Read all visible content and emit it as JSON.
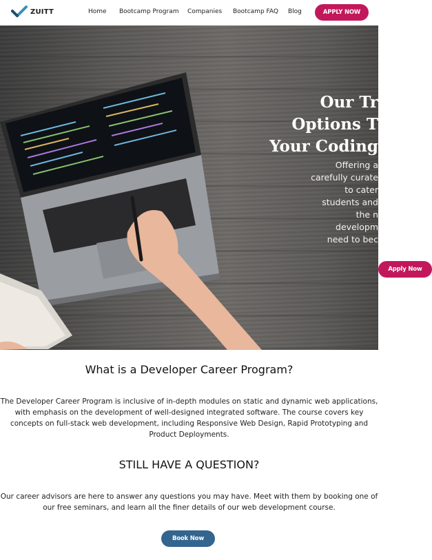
{
  "header": {
    "logo_text": "ZUITT",
    "nav": [
      "Home",
      "Bootcamp Program",
      "Companies",
      "Bootcamp FAQ",
      "Blog"
    ],
    "apply_label": "APPLY NOW"
  },
  "hero": {
    "title_lines": [
      "Our Tr",
      "Options T",
      "Your Coding"
    ],
    "desc_lines": [
      "Offering a",
      "carefully curate",
      "to cater",
      "students and",
      "the n",
      "developm",
      "need to bec"
    ],
    "apply_label": "Apply Now"
  },
  "program": {
    "heading": "What is a Developer Career Program?",
    "lines": [
      "The Developer Career Program is inclusive of in-depth modules on static and dynamic web applications,",
      "with emphasis on the development of well-designed integrated software. The course covers key",
      "concepts on full-stack web development, including Responsive Web Design, Rapid Prototyping and",
      "Product Deployments."
    ]
  },
  "question": {
    "heading": "STILL HAVE A QUESTION?",
    "lines": [
      "Our career advisors are here to answer any questions you may have. Meet with them by booking one of",
      "our free seminars, and learn all the finer details of our web development course."
    ],
    "button_label": "Book Now"
  },
  "colors": {
    "accent": "#c2185b",
    "book_button": "#34658f"
  }
}
